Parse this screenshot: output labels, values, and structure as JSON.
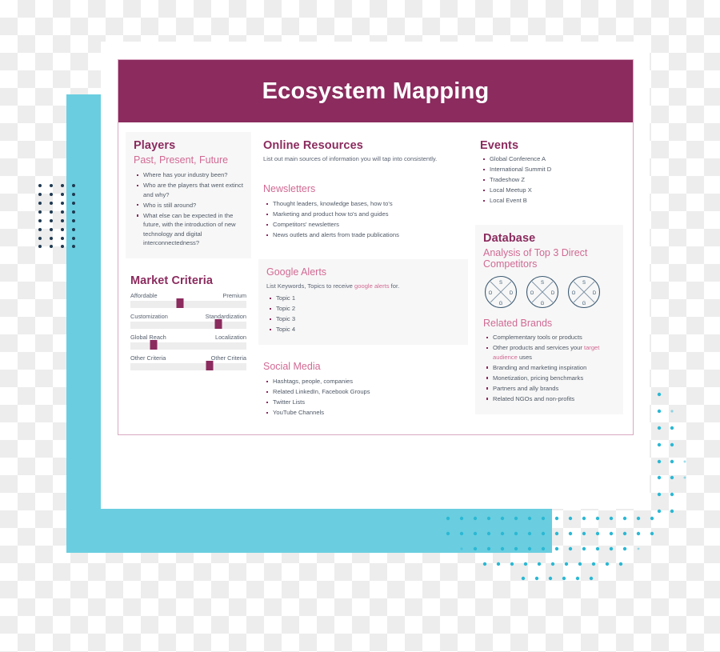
{
  "banner": {
    "title": "Ecosystem Mapping"
  },
  "colors": {
    "banner_bg": "#8B2B5E",
    "accent_magenta": "#8B2B5E",
    "accent_pink": "#D16A93",
    "cyan_block": "#6ACEE0",
    "dots_navy": "#1F3A52",
    "dots_cyan": "#2BB8D4",
    "tile_bg": "#F7F7F7",
    "card_border": "#D9A8C2",
    "body_text": "#4F5966"
  },
  "players": {
    "heading": "Players",
    "subheading": "Past, Present, Future",
    "items": [
      "Where has your industry been?",
      "Who are the players that went extinct and why?",
      "Who is still around?",
      "What else can be expected in the future, with the introduction of new technology and digital interconnectedness?"
    ]
  },
  "market_criteria": {
    "heading": "Market Criteria",
    "rows": [
      {
        "left_label": "Affordable",
        "right_label": "Premium",
        "value_pct": 43
      },
      {
        "left_label": "Customization",
        "right_label": "Standardization",
        "value_pct": 76
      },
      {
        "left_label": "Global Reach",
        "right_label": "Localization",
        "value_pct": 20
      },
      {
        "left_label": "Other Criteria",
        "right_label": "Other Criteria",
        "value_pct": 68
      }
    ]
  },
  "online_resources": {
    "heading": "Online Resources",
    "description": "List out main sources of information you will tap into consistently."
  },
  "newsletters": {
    "heading": "Newsletters",
    "items": [
      "Thought leaders, knowledge bases, how to's",
      "Marketing and product how to's and guides",
      "Competitors' newsletters",
      "News outlets and alerts from trade publications"
    ]
  },
  "google_alerts": {
    "heading": "Google Alerts",
    "description_before": "List Keywords, Topics to receive ",
    "description_highlight": "google alerts",
    "description_after": " for.",
    "items": [
      "Topic 1",
      "Topic 2",
      "Topic 3",
      "Topic 4"
    ]
  },
  "social_media": {
    "heading": "Social Media",
    "items": [
      "Hashtags, people, companies",
      "Related LinkedIn, Facebook Groups",
      "Twitter Lists",
      "YouTube Channels"
    ]
  },
  "events": {
    "heading": "Events",
    "items": [
      "Global Conference A",
      "International Summit D",
      "Tradeshow Z",
      "Local Meetup X",
      "Local Event B"
    ]
  },
  "database": {
    "heading": "Database",
    "subheading": "Analysis of Top 3 Direct Competitors",
    "diagram_labels": {
      "top": "S",
      "left": "O",
      "right": "D",
      "bottom": "G"
    },
    "diagram_count": 3
  },
  "related_brands": {
    "heading": "Related Brands",
    "items": [
      {
        "text": "Complementary tools or products"
      },
      {
        "before": "Other products and services your ",
        "highlight": "target audience",
        "after": " uses"
      },
      {
        "text": "Branding and marketing inspiration"
      },
      {
        "text": "Monetization, pricing benchmarks"
      },
      {
        "text": "Partners and ally brands"
      },
      {
        "text": "Related NGOs and non-profits"
      }
    ]
  }
}
